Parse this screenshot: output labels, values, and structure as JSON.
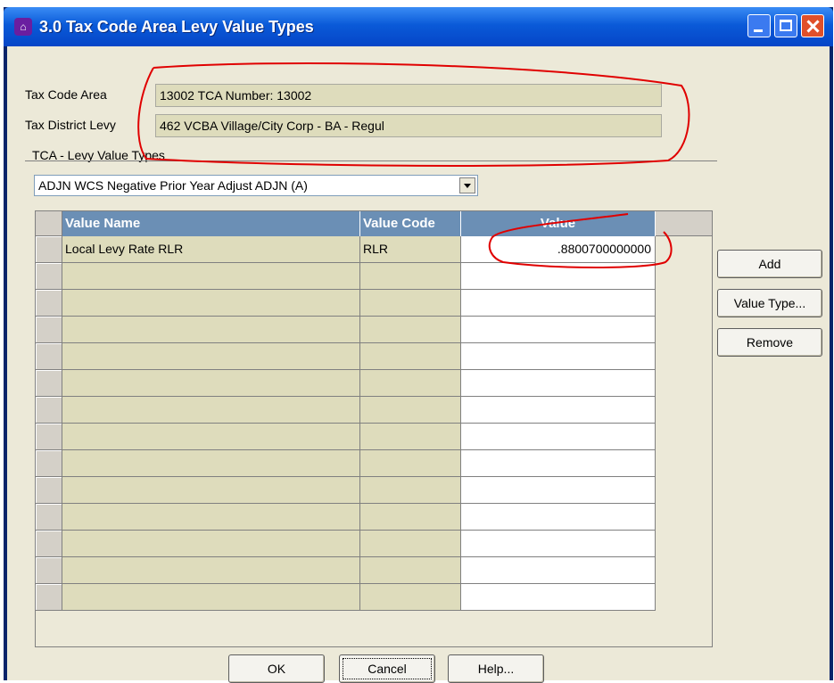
{
  "window": {
    "title": "3.0 Tax Code Area Levy Value Types",
    "app_icon": "app-icon"
  },
  "form": {
    "tax_code_area_label": "Tax Code Area",
    "tax_code_area_value": "13002 TCA Number: 13002",
    "tax_district_levy_label": "Tax District Levy",
    "tax_district_levy_value": "462 VCBA Village/City Corp - BA - Regul",
    "section_label": "TCA - Levy Value Types",
    "value_type_selected": "ADJN WCS Negative Prior Year Adjust ADJN (A)"
  },
  "grid": {
    "columns": [
      "Value Name",
      "Value Code",
      "Value"
    ],
    "rows": [
      {
        "name": "Local Levy Rate RLR",
        "code": "RLR",
        "value": ".8800700000000"
      }
    ],
    "empty_rows": 13
  },
  "side_buttons": {
    "add": "Add",
    "value_type": "Value Type...",
    "remove": "Remove"
  },
  "bottom_buttons": {
    "ok": "OK",
    "cancel": "Cancel",
    "help": "Help..."
  },
  "colors": {
    "title_bar": "#0a5ad8",
    "grid_header": "#6b8fb5",
    "readonly_field": "#dedcbc",
    "annotation": "#e00000"
  }
}
